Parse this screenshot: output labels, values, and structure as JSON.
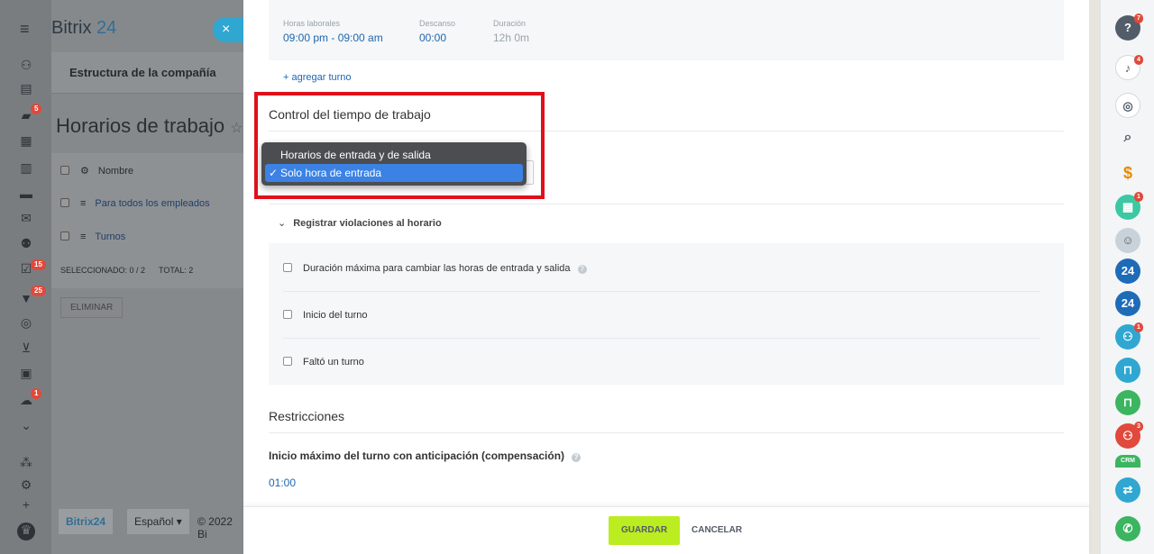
{
  "left_nav": {
    "badges": [
      "5",
      "15",
      "25",
      "1"
    ]
  },
  "portal": {
    "logo_text": "Bitrix",
    "logo_num": "24",
    "close_glyph": "×",
    "tab_label": "Estructura de la compañía",
    "page_title": "Horarios de trabajo",
    "table": {
      "header": "Nombre",
      "rows": [
        "Para todos los empleados",
        "Turnos"
      ],
      "selected": "SELECCIONADO: 0 / 2",
      "total": "TOTAL: 2",
      "delete": "ELIMINAR"
    },
    "footer_logo": "Bitrix24",
    "language": "Español",
    "copyright": "© 2022 Bi"
  },
  "shift": {
    "working_hours_label": "Horas laborales",
    "working_hours_value": "09:00 pm - 09:00 am",
    "break_label": "Descanso",
    "break_value": "00:00",
    "duration_label": "Duración",
    "duration_value": "12h 0m",
    "add_shift": "+ agregar turno"
  },
  "time_control": {
    "title": "Control del tiempo de trabajo",
    "options": [
      "Horarios de entrada y de salida",
      "Solo hora de entrada"
    ],
    "selected_index": 1,
    "check_glyph": "✓"
  },
  "violations": {
    "heading": "Registrar violaciones al horario",
    "items": [
      "Duración máxima para cambiar las horas de entrada y salida",
      "Inicio del turno",
      "Faltó un turno"
    ]
  },
  "restrictions": {
    "title": "Restricciones",
    "max_start_label": "Inicio máximo del turno con anticipación (compensación)",
    "max_start_value": "01:00"
  },
  "footer": {
    "save": "GUARDAR",
    "cancel": "CANCELAR"
  },
  "right_bar": {
    "badges": [
      "7",
      "4",
      "1",
      "1",
      "3"
    ],
    "bitrix_label": "24",
    "crm_label": "CRM"
  },
  "colors": {
    "accent_link": "#2067b0",
    "save_button": "#bbed21",
    "highlight_border": "#e0101a",
    "dropdown_selected": "#3b82e4"
  }
}
